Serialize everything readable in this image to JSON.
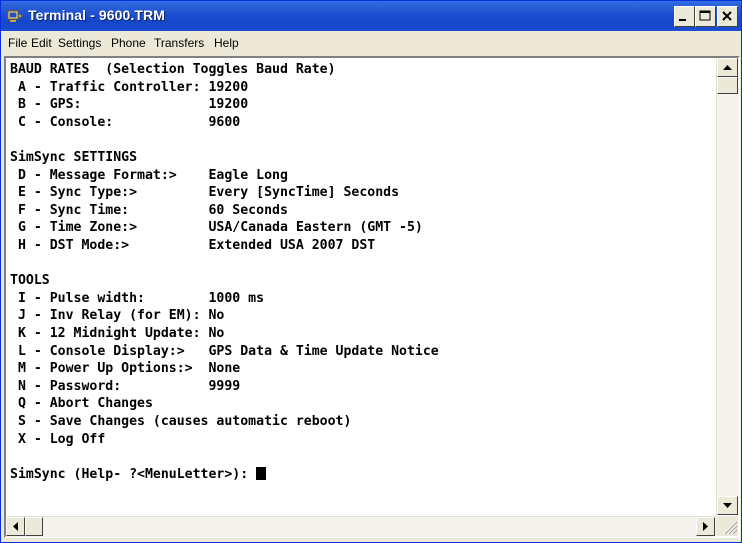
{
  "window": {
    "title": "Terminal - 9600.TRM"
  },
  "menu": [
    "File",
    "Edit",
    "Settings",
    "Phone",
    "Transfers",
    "Help"
  ],
  "terminal_lines": [
    "BAUD RATES  (Selection Toggles Baud Rate)",
    " A - Traffic Controller: 19200",
    " B - GPS:                19200",
    " C - Console:            9600",
    "",
    "SimSync SETTINGS",
    " D - Message Format:>    Eagle Long",
    " E - Sync Type:>         Every [SyncTime] Seconds",
    " F - Sync Time:          60 Seconds",
    " G - Time Zone:>         USA/Canada Eastern (GMT -5)",
    " H - DST Mode:>          Extended USA 2007 DST",
    "",
    "TOOLS",
    " I - Pulse width:        1000 ms",
    " J - Inv Relay (for EM): No",
    " K - 12 Midnight Update: No",
    " L - Console Display:>   GPS Data & Time Update Notice",
    " M - Power Up Options:>  None",
    " N - Password:           9999",
    " Q - Abort Changes",
    " S - Save Changes (causes automatic reboot)",
    " X - Log Off",
    "",
    "SimSync (Help- ?<MenuLetter>): "
  ]
}
